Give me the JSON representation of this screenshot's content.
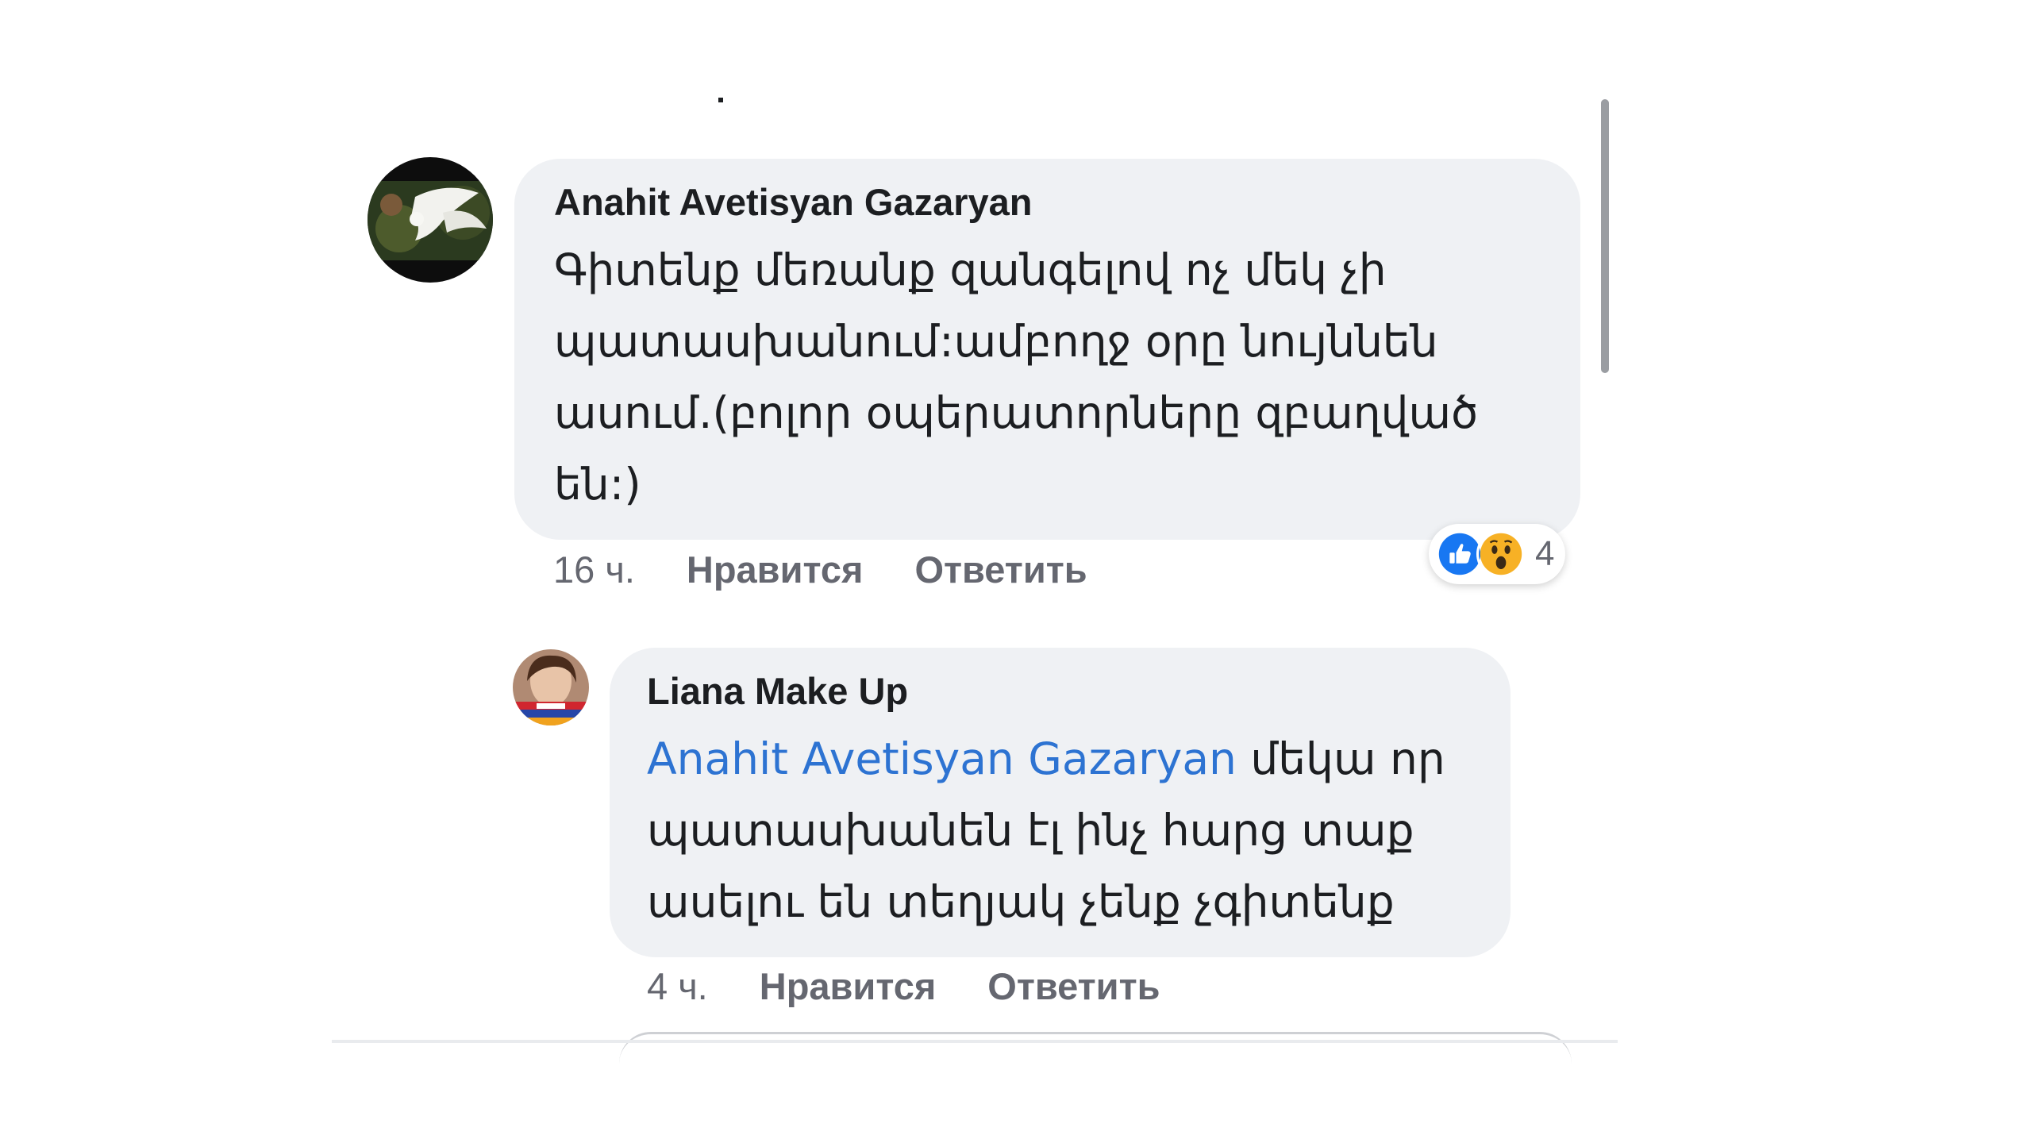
{
  "comments": [
    {
      "author": "Anahit Avetisyan Gazaryan",
      "text": "Գիտենք մեռանք զանգելով ոչ մեկ չի պատասխանում:ամբողջ օրը նույննեն ասում.(բոլոր օպերատորները զբաղված են:)",
      "time": "16 ч.",
      "like_label": "Нравится",
      "reply_label": "Ответить",
      "reaction_icons": [
        "like-icon",
        "wow-icon"
      ],
      "reaction_count": "4"
    },
    {
      "author": "Liana Make Up",
      "mention": "Anahit Avetisyan Gazaryan",
      "text": "մեկա որ պատասխանեն էլ ինչ հարց տաք ասելու են տեղյակ չենք չգիտենք",
      "time": "4 ч.",
      "like_label": "Нравится",
      "reply_label": "Ответить"
    }
  ],
  "colors": {
    "bubble": "#eff1f4",
    "mention": "#2d73d2",
    "meta": "#656770",
    "like_blue": "#1877f2",
    "wow_yellow": "#f7b125"
  }
}
